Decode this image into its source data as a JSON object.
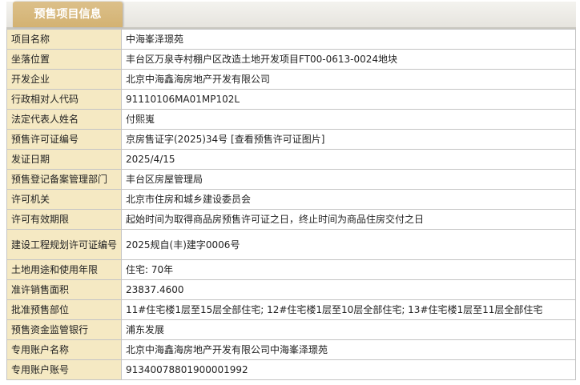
{
  "tab_title": "预售项目信息",
  "rows": [
    {
      "label": "项目名称",
      "value": "中海峯泽璟苑"
    },
    {
      "label": "坐落位置",
      "value": "丰台区万泉寺村棚户区改造土地开发项目FT00-0613-0024地块"
    },
    {
      "label": "开发企业",
      "value": "北京中海鑫海房地产开发有限公司"
    },
    {
      "label": "行政相对人代码",
      "value": "91110106MA01MP102L"
    },
    {
      "label": "法定代表人姓名",
      "value": "付熙嵬"
    },
    {
      "label": "预售许可证编号",
      "value": "京房售证字(2025)34号",
      "link": "[查看预售许可证图片]"
    },
    {
      "label": "发证日期",
      "value": "2025/4/15"
    },
    {
      "label": "预售登记备案管理部门",
      "value": "丰台区房屋管理局"
    },
    {
      "label": "许可机关",
      "value": "北京市住房和城乡建设委员会"
    },
    {
      "label": "许可有效期限",
      "value": "起始时间为取得商品房预售许可证之日，终止时间为商品住房交付之日"
    },
    {
      "label": "建设工程规划许可证编号",
      "value": "2025规自(丰)建字0006号"
    },
    {
      "label": "土地用途和使用年限",
      "value": "住宅: 70年"
    },
    {
      "label": "准许销售面积",
      "value": "23837.4600"
    },
    {
      "label": "批准预售部位",
      "value": "11#住宅楼1层至15层全部住宅; 12#住宅楼1层至10层全部住宅; 13#住宅楼1层至11层全部住宅"
    },
    {
      "label": "预售资金监管银行",
      "value": "浦东发展"
    },
    {
      "label": "专用账户名称",
      "value": "北京中海鑫海房地产开发有限公司中海峯泽璟苑"
    },
    {
      "label": "专用账户账号",
      "value": "91340078801900001992"
    }
  ]
}
